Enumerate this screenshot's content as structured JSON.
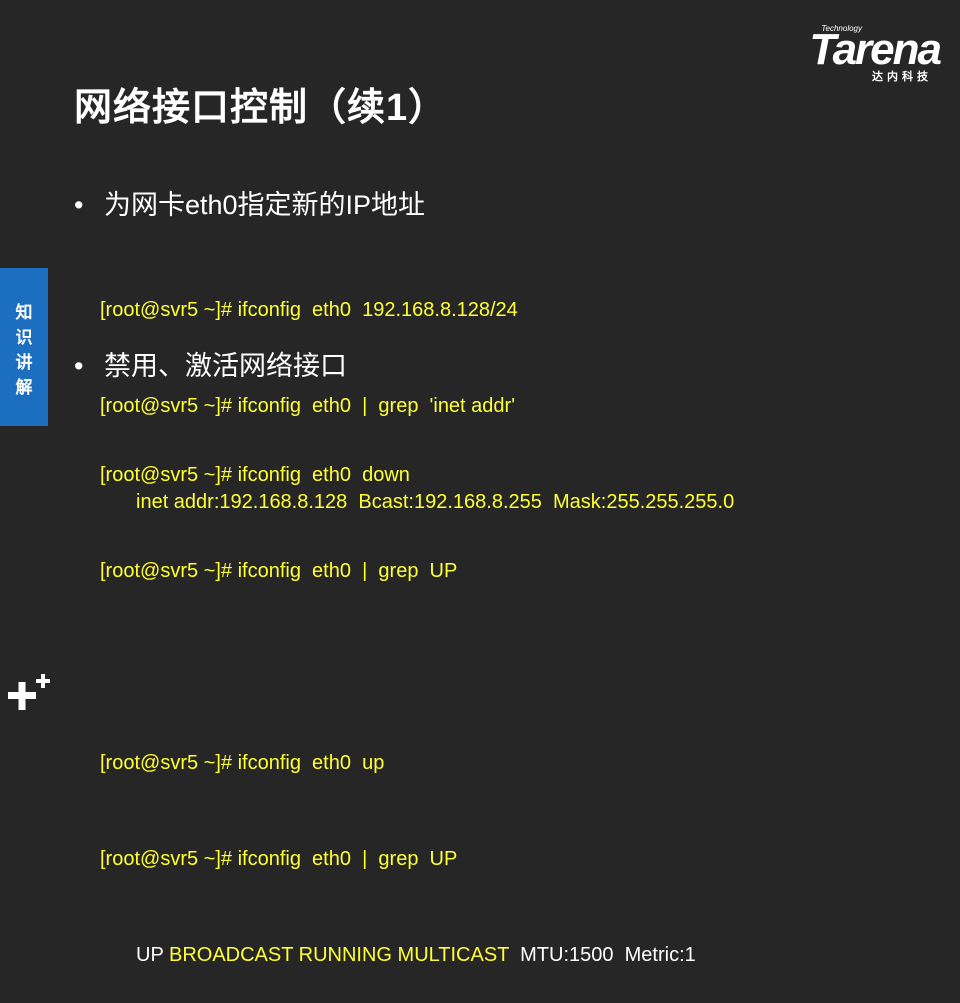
{
  "title": "网络接口控制（续1）",
  "logo": {
    "tech": "Technology",
    "main": "Tarena",
    "sub": "达内科技"
  },
  "side_tab": [
    "知",
    "识",
    "讲",
    "解"
  ],
  "bullets": [
    {
      "text": "为网卡eth0指定新的IP地址"
    },
    {
      "text": "禁用、激活网络接口"
    }
  ],
  "code_block_1": [
    "[root@svr5 ~]# ifconfig  eth0  192.168.8.128/24",
    "[root@svr5 ~]# ifconfig  eth0  |  grep  'inet addr'",
    "inet addr:192.168.8.128  Bcast:192.168.8.255  Mask:255.255.255.0"
  ],
  "code_block_2": [
    "[root@svr5 ~]# ifconfig  eth0  down",
    "[root@svr5 ~]# ifconfig  eth0  |  grep  UP",
    "",
    "[root@svr5 ~]# ifconfig  eth0  up",
    "[root@svr5 ~]# ifconfig  eth0  |  grep  UP"
  ],
  "code_last_line": {
    "prefix": "UP ",
    "mid": "BROADCAST RUNNING MULTICAST",
    "suffix": "  MTU:1500  Metric:1"
  },
  "colors": {
    "background": "#262626",
    "code": "#ffff33",
    "side_tab": "#1c6ec0"
  },
  "icons": {
    "bullet": "bullet-dot-icon",
    "plus": "plus-icon"
  }
}
